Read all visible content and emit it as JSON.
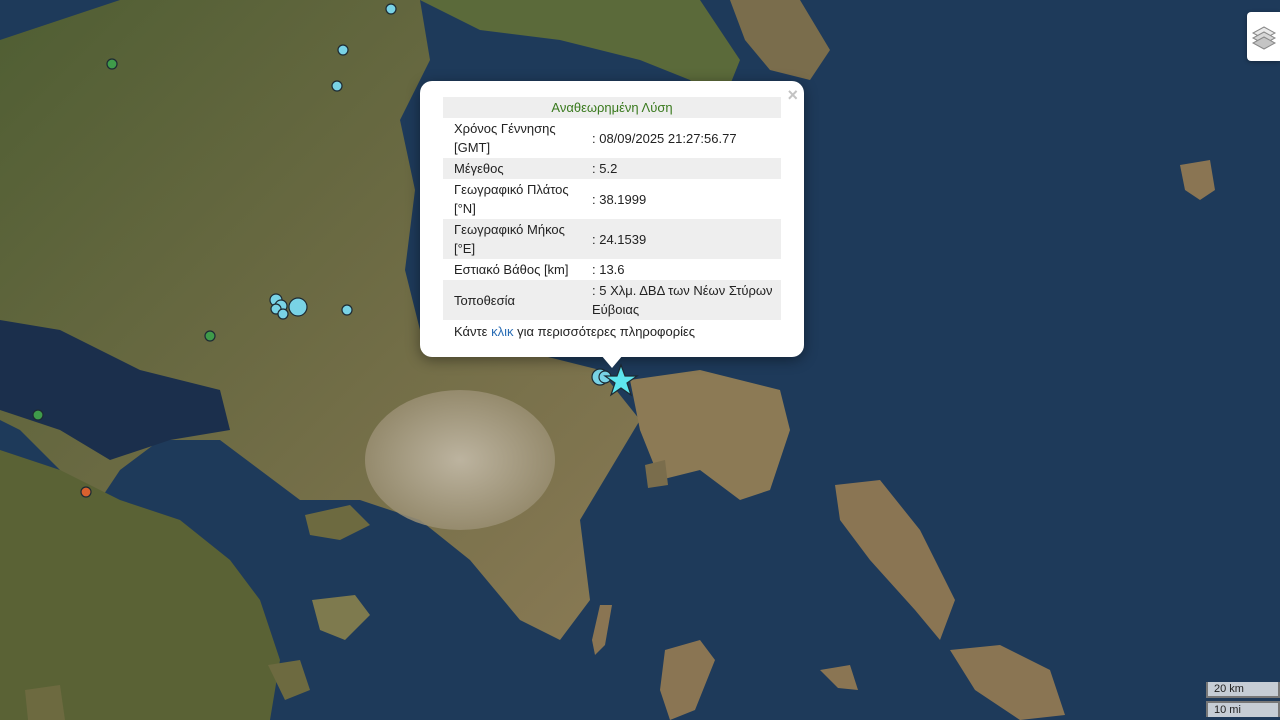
{
  "popup": {
    "title": "Αναθεωρημένη Λύση",
    "close_label": "×",
    "rows": [
      {
        "label": "Χρόνος Γέννησης [GMT]",
        "value": ": 08/09/2025 21:27:56.77"
      },
      {
        "label": "Μέγεθος",
        "value": ": 5.2"
      },
      {
        "label": "Γεωγραφικό Πλάτος [°N]",
        "value": ": 38.1999"
      },
      {
        "label": "Γεωγραφικό Μήκος [°E]",
        "value": ": 24.1539"
      },
      {
        "label": "Εστιακό Βάθος [km]",
        "value": ": 13.6"
      },
      {
        "label": "Τοποθεσία",
        "value": ": 5 Χλμ. ΔΒΔ των Νέων Στύρων Εύβοιας"
      }
    ],
    "more_prefix": "Κάντε ",
    "more_link": "κλικ",
    "more_suffix": " για περισσότερες πληροφορίες"
  },
  "scale": {
    "km_label": "20 km",
    "mi_label": "10 mi"
  },
  "layers_control": {
    "icon": "layers-icon"
  },
  "colors": {
    "quake_cyan": "#79d3e6",
    "quake_green": "#3f9b4a",
    "quake_orange": "#d9612f",
    "epicenter_star": "#5ee6ef",
    "popup_title_green": "#3a7a1e",
    "link_blue": "#2a6db5"
  }
}
